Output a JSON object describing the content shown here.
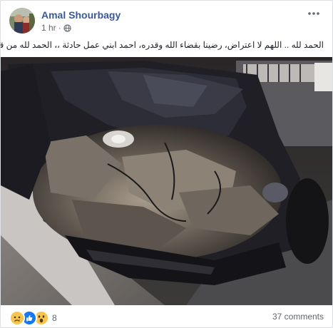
{
  "post": {
    "author": "Amal Shourbagy",
    "time": "1 hr",
    "separator": "·",
    "privacy_icon": "globe-icon",
    "more_icon": "more-dots-icon",
    "text": "الحمد لله .. اللهم لا اعتراض، رضينا بقضاء الله وقدره، احمد ابني عمل حادثة ،، الحمد لله من قبل ومن بعد"
  },
  "photo": {
    "subject": "car-front-crash-photo"
  },
  "footer": {
    "reaction_icons": [
      "sad-icon",
      "like-icon",
      "wow-icon"
    ],
    "reaction_count": "8",
    "comments": "37 comments"
  },
  "colors": {
    "author": "#385898",
    "like": "#1877f2",
    "emoji": "#f7c54d",
    "meta": "#616770"
  }
}
